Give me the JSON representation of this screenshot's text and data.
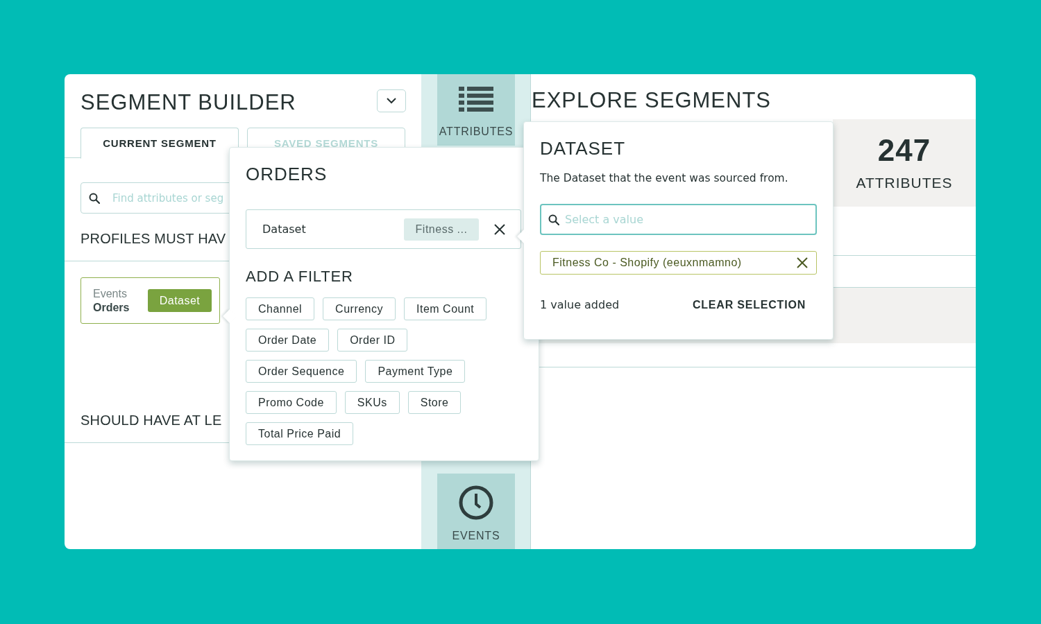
{
  "segment_builder": {
    "title": "SEGMENT BUILDER",
    "tabs": [
      {
        "label": "CURRENT SEGMENT",
        "selected": true
      },
      {
        "label": "SAVED SEGMENTS",
        "selected": false
      }
    ],
    "search": {
      "placeholder": "Find attributes or seg"
    },
    "sections": [
      {
        "heading": "PROFILES MUST HAV",
        "conditions": [
          {
            "source": "Events",
            "name": "Orders",
            "attribute": "Dataset"
          }
        ]
      },
      {
        "heading": "SHOULD HAVE AT LE"
      }
    ]
  },
  "rail": [
    {
      "kind": "list",
      "label": "ATTRIBUTES"
    },
    {
      "kind": "clock",
      "label": "EVENTS"
    }
  ],
  "explore_segments": {
    "title": "EXPLORE SEGMENTS",
    "stat": {
      "value": "247",
      "label": "ATTRIBUTES"
    }
  },
  "orders_popover": {
    "title": "ORDERS",
    "applied_filters": [
      {
        "name": "Dataset",
        "value": "Fitness ..."
      }
    ],
    "add_filter_heading": "ADD A FILTER",
    "filters": [
      "Channel",
      "Currency",
      "Item Count",
      "Order Date",
      "Order ID",
      "Order Sequence",
      "Payment Type",
      "Promo Code",
      "SKUs",
      "Store",
      "Total Price Paid"
    ]
  },
  "dataset_popover": {
    "title": "DATASET",
    "description": "The Dataset that the event was sourced from.",
    "search": {
      "placeholder": "Select a value"
    },
    "selected_values": [
      "Fitness Co - Shopify (eeuxnmamno)"
    ],
    "count_text": "1 value added",
    "clear_button": "CLEAR SELECTION"
  }
}
